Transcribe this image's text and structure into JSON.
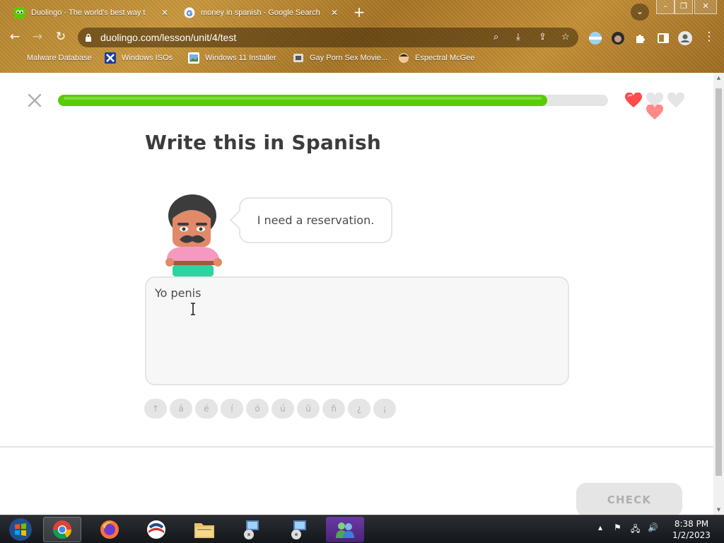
{
  "browser": {
    "tabs": [
      {
        "title": "Duolingo - The world's best way t",
        "active": true
      },
      {
        "title": "money in spanish - Google Search",
        "active": false
      }
    ],
    "new_tab_icon": "plus-icon",
    "url": "duolingo.com/lesson/unit/4/test",
    "bookmarks": [
      {
        "label": "Malware Database",
        "icon": "folder-icon"
      },
      {
        "label": "Windows ISOs",
        "icon": "x-logo-icon"
      },
      {
        "label": "Windows 11 Installer",
        "icon": "image-icon"
      },
      {
        "label": "Gay Porn Sex Movie...",
        "icon": "bookmark-favicon"
      },
      {
        "label": "Espectral McGee",
        "icon": "avatar-icon"
      }
    ]
  },
  "lesson": {
    "progress_percent": 89,
    "hearts": {
      "filled": 1,
      "total": 3
    },
    "heading": "Write this in Spanish",
    "prompt": "I need a reservation.",
    "answer_value": "Yo penis",
    "special_chars": [
      "↑",
      "á",
      "é",
      "í",
      "ó",
      "ú",
      "ü",
      "ñ",
      "¿",
      "¡"
    ],
    "check_label": "CHECK"
  },
  "taskbar": {
    "time": "8:38 PM",
    "date": "1/2/2023"
  },
  "colors": {
    "progress_fill": "#58cc02",
    "heart": "#ff4b4b",
    "heading": "#3c3c3c",
    "disabled": "#e5e5e5"
  }
}
